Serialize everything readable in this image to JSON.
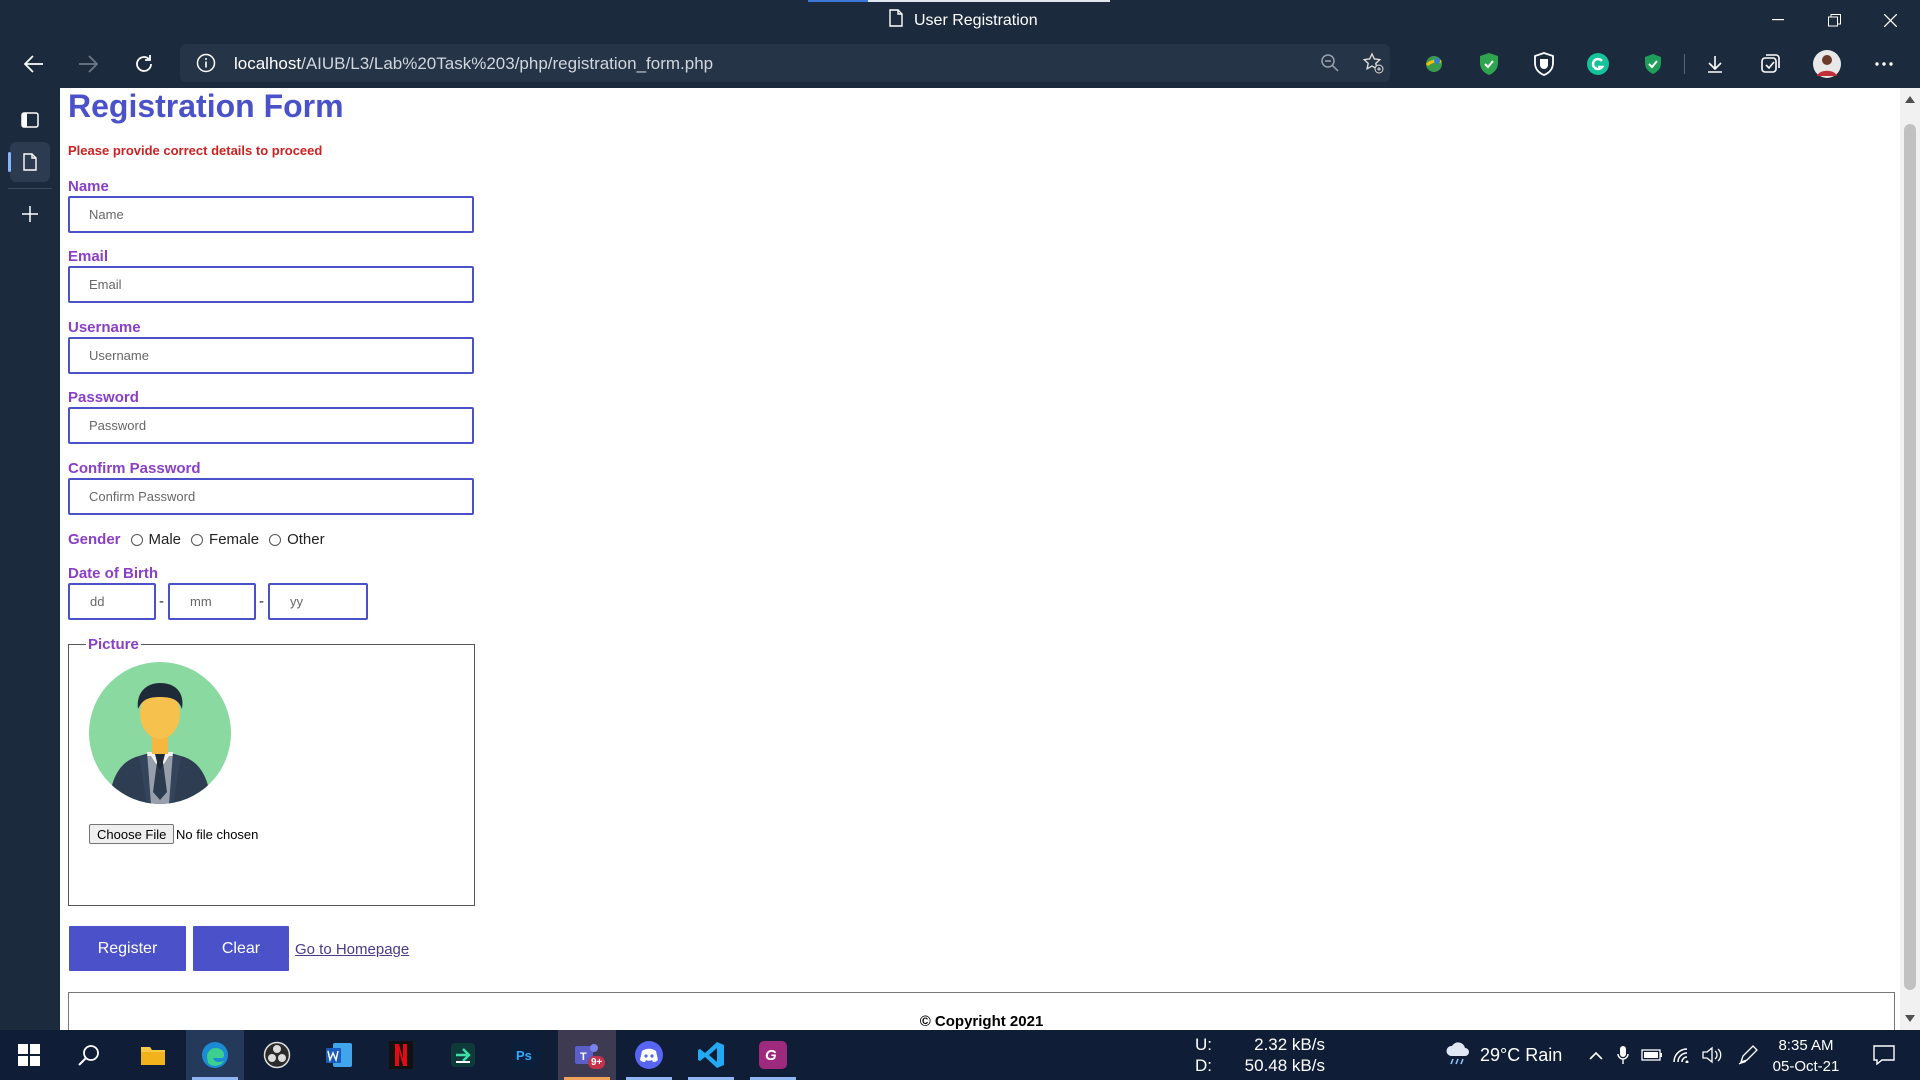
{
  "browser": {
    "tab_title": "User Registration",
    "url_host": "localhost",
    "url_path": "/AIUB/L3/Lab%20Task%203/php/registration_form.php"
  },
  "page": {
    "title": "Registration Form",
    "subtitle": "Please provide correct details to proceed",
    "name": {
      "label": "Name",
      "placeholder": "Name"
    },
    "email": {
      "label": "Email",
      "placeholder": "Email"
    },
    "username": {
      "label": "Username",
      "placeholder": "Username"
    },
    "password": {
      "label": "Password",
      "placeholder": "Password"
    },
    "confirm_password": {
      "label": "Confirm Password",
      "placeholder": "Confirm Password"
    },
    "gender": {
      "label": "Gender",
      "options": [
        "Male",
        "Female",
        "Other"
      ]
    },
    "dob": {
      "label": "Date of Birth",
      "dd": "dd",
      "mm": "mm",
      "yy": "yy",
      "separator": "-"
    },
    "picture": {
      "legend": "Picture",
      "choose_file": "Choose File",
      "no_file": "No file chosen"
    },
    "register_label": "Register",
    "clear_label": "Clear",
    "home_link": "Go to Homepage",
    "footer": "© Copyright 2021"
  },
  "taskbar": {
    "net_up_label": "U:",
    "net_up_value": "2.32 kB/s",
    "net_down_label": "D:",
    "net_down_value": "50.48 kB/s",
    "weather": "29°C  Rain",
    "time": "8:35 AM",
    "date": "05-Oct-21",
    "teams_badge": "9+"
  },
  "colors": {
    "accent": "#4b52c9",
    "label": "#8a3fc7",
    "error": "#cc2222",
    "chrome": "#1b2a3d",
    "taskbar": "#0f1e36"
  },
  "icons": [
    "page-icon",
    "back-icon",
    "forward-icon",
    "refresh-icon",
    "info-icon",
    "zoom-icon",
    "favorite-add-icon",
    "extension-icons",
    "download-icon",
    "collections-icon",
    "profile-avatar",
    "more-icon",
    "tab-actions-icon",
    "vertical-tab-icon",
    "new-tab-icon",
    "windows-start-icon",
    "search-icon",
    "file-explorer-icon",
    "edge-icon",
    "obs-icon",
    "word-icon",
    "netflix-icon",
    "photoshop-icon",
    "teams-icon",
    "discord-icon",
    "vscode-icon",
    "pdf-icon",
    "weather-icon",
    "notification-icon"
  ]
}
